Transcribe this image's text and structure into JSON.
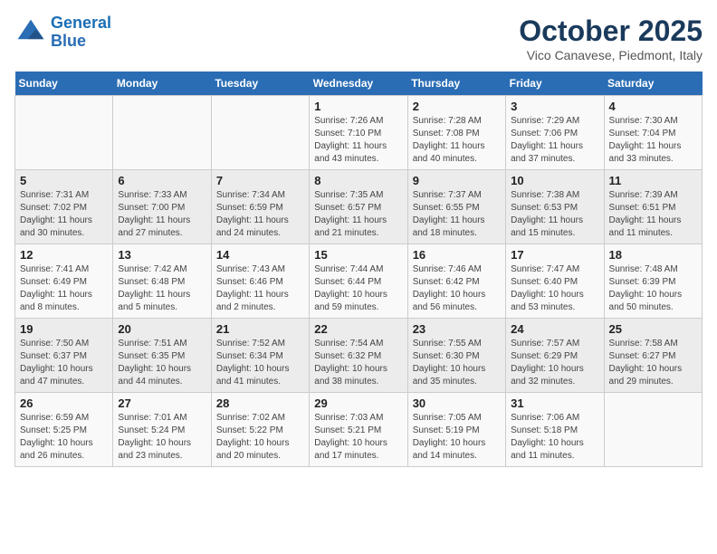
{
  "header": {
    "logo_line1": "General",
    "logo_line2": "Blue",
    "month": "October 2025",
    "location": "Vico Canavese, Piedmont, Italy"
  },
  "days_of_week": [
    "Sunday",
    "Monday",
    "Tuesday",
    "Wednesday",
    "Thursday",
    "Friday",
    "Saturday"
  ],
  "weeks": [
    [
      {
        "day": "",
        "info": ""
      },
      {
        "day": "",
        "info": ""
      },
      {
        "day": "",
        "info": ""
      },
      {
        "day": "1",
        "info": "Sunrise: 7:26 AM\nSunset: 7:10 PM\nDaylight: 11 hours\nand 43 minutes."
      },
      {
        "day": "2",
        "info": "Sunrise: 7:28 AM\nSunset: 7:08 PM\nDaylight: 11 hours\nand 40 minutes."
      },
      {
        "day": "3",
        "info": "Sunrise: 7:29 AM\nSunset: 7:06 PM\nDaylight: 11 hours\nand 37 minutes."
      },
      {
        "day": "4",
        "info": "Sunrise: 7:30 AM\nSunset: 7:04 PM\nDaylight: 11 hours\nand 33 minutes."
      }
    ],
    [
      {
        "day": "5",
        "info": "Sunrise: 7:31 AM\nSunset: 7:02 PM\nDaylight: 11 hours\nand 30 minutes."
      },
      {
        "day": "6",
        "info": "Sunrise: 7:33 AM\nSunset: 7:00 PM\nDaylight: 11 hours\nand 27 minutes."
      },
      {
        "day": "7",
        "info": "Sunrise: 7:34 AM\nSunset: 6:59 PM\nDaylight: 11 hours\nand 24 minutes."
      },
      {
        "day": "8",
        "info": "Sunrise: 7:35 AM\nSunset: 6:57 PM\nDaylight: 11 hours\nand 21 minutes."
      },
      {
        "day": "9",
        "info": "Sunrise: 7:37 AM\nSunset: 6:55 PM\nDaylight: 11 hours\nand 18 minutes."
      },
      {
        "day": "10",
        "info": "Sunrise: 7:38 AM\nSunset: 6:53 PM\nDaylight: 11 hours\nand 15 minutes."
      },
      {
        "day": "11",
        "info": "Sunrise: 7:39 AM\nSunset: 6:51 PM\nDaylight: 11 hours\nand 11 minutes."
      }
    ],
    [
      {
        "day": "12",
        "info": "Sunrise: 7:41 AM\nSunset: 6:49 PM\nDaylight: 11 hours\nand 8 minutes."
      },
      {
        "day": "13",
        "info": "Sunrise: 7:42 AM\nSunset: 6:48 PM\nDaylight: 11 hours\nand 5 minutes."
      },
      {
        "day": "14",
        "info": "Sunrise: 7:43 AM\nSunset: 6:46 PM\nDaylight: 11 hours\nand 2 minutes."
      },
      {
        "day": "15",
        "info": "Sunrise: 7:44 AM\nSunset: 6:44 PM\nDaylight: 10 hours\nand 59 minutes."
      },
      {
        "day": "16",
        "info": "Sunrise: 7:46 AM\nSunset: 6:42 PM\nDaylight: 10 hours\nand 56 minutes."
      },
      {
        "day": "17",
        "info": "Sunrise: 7:47 AM\nSunset: 6:40 PM\nDaylight: 10 hours\nand 53 minutes."
      },
      {
        "day": "18",
        "info": "Sunrise: 7:48 AM\nSunset: 6:39 PM\nDaylight: 10 hours\nand 50 minutes."
      }
    ],
    [
      {
        "day": "19",
        "info": "Sunrise: 7:50 AM\nSunset: 6:37 PM\nDaylight: 10 hours\nand 47 minutes."
      },
      {
        "day": "20",
        "info": "Sunrise: 7:51 AM\nSunset: 6:35 PM\nDaylight: 10 hours\nand 44 minutes."
      },
      {
        "day": "21",
        "info": "Sunrise: 7:52 AM\nSunset: 6:34 PM\nDaylight: 10 hours\nand 41 minutes."
      },
      {
        "day": "22",
        "info": "Sunrise: 7:54 AM\nSunset: 6:32 PM\nDaylight: 10 hours\nand 38 minutes."
      },
      {
        "day": "23",
        "info": "Sunrise: 7:55 AM\nSunset: 6:30 PM\nDaylight: 10 hours\nand 35 minutes."
      },
      {
        "day": "24",
        "info": "Sunrise: 7:57 AM\nSunset: 6:29 PM\nDaylight: 10 hours\nand 32 minutes."
      },
      {
        "day": "25",
        "info": "Sunrise: 7:58 AM\nSunset: 6:27 PM\nDaylight: 10 hours\nand 29 minutes."
      }
    ],
    [
      {
        "day": "26",
        "info": "Sunrise: 6:59 AM\nSunset: 5:25 PM\nDaylight: 10 hours\nand 26 minutes."
      },
      {
        "day": "27",
        "info": "Sunrise: 7:01 AM\nSunset: 5:24 PM\nDaylight: 10 hours\nand 23 minutes."
      },
      {
        "day": "28",
        "info": "Sunrise: 7:02 AM\nSunset: 5:22 PM\nDaylight: 10 hours\nand 20 minutes."
      },
      {
        "day": "29",
        "info": "Sunrise: 7:03 AM\nSunset: 5:21 PM\nDaylight: 10 hours\nand 17 minutes."
      },
      {
        "day": "30",
        "info": "Sunrise: 7:05 AM\nSunset: 5:19 PM\nDaylight: 10 hours\nand 14 minutes."
      },
      {
        "day": "31",
        "info": "Sunrise: 7:06 AM\nSunset: 5:18 PM\nDaylight: 10 hours\nand 11 minutes."
      },
      {
        "day": "",
        "info": ""
      }
    ]
  ]
}
